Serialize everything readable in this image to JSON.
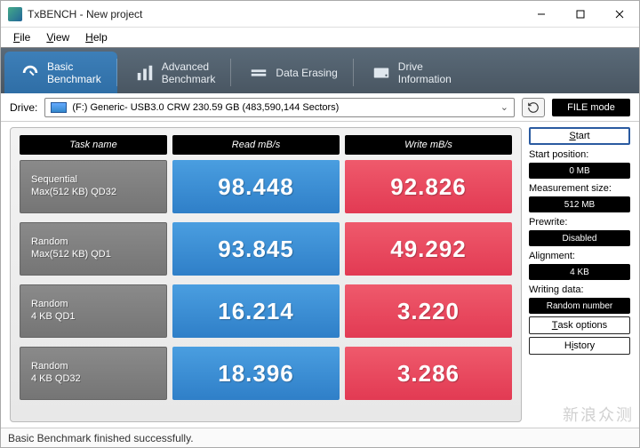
{
  "window": {
    "title": "TxBENCH - New project"
  },
  "menu": {
    "file": "File",
    "view": "View",
    "help": "Help"
  },
  "tabs": {
    "basic": "Basic\nBenchmark",
    "advanced": "Advanced\nBenchmark",
    "erase": "Data Erasing",
    "drive": "Drive\nInformation"
  },
  "drive": {
    "label": "Drive:",
    "selected": "(F:) Generic- USB3.0 CRW   230.59 GB (483,590,144 Sectors)"
  },
  "filemode": "FILE mode",
  "headers": {
    "task": "Task name",
    "read": "Read  mB/s",
    "write": "Write  mB/s"
  },
  "rows": [
    {
      "name1": "Sequential",
      "name2": "Max(512 KB) QD32",
      "read": "98.448",
      "write": "92.826"
    },
    {
      "name1": "Random",
      "name2": "Max(512 KB) QD1",
      "read": "93.845",
      "write": "49.292"
    },
    {
      "name1": "Random",
      "name2": "4 KB QD1",
      "read": "16.214",
      "write": "3.220"
    },
    {
      "name1": "Random",
      "name2": "4 KB QD32",
      "read": "18.396",
      "write": "3.286"
    }
  ],
  "side": {
    "start": "Start",
    "startpos_lbl": "Start position:",
    "startpos": "0 MB",
    "meas_lbl": "Measurement size:",
    "meas": "512 MB",
    "prewrite_lbl": "Prewrite:",
    "prewrite": "Disabled",
    "align_lbl": "Alignment:",
    "align": "4 KB",
    "wdata_lbl": "Writing data:",
    "wdata": "Random number",
    "taskopt": "Task options",
    "history": "History"
  },
  "status": "Basic Benchmark finished successfully.",
  "watermark": "新浪众测"
}
